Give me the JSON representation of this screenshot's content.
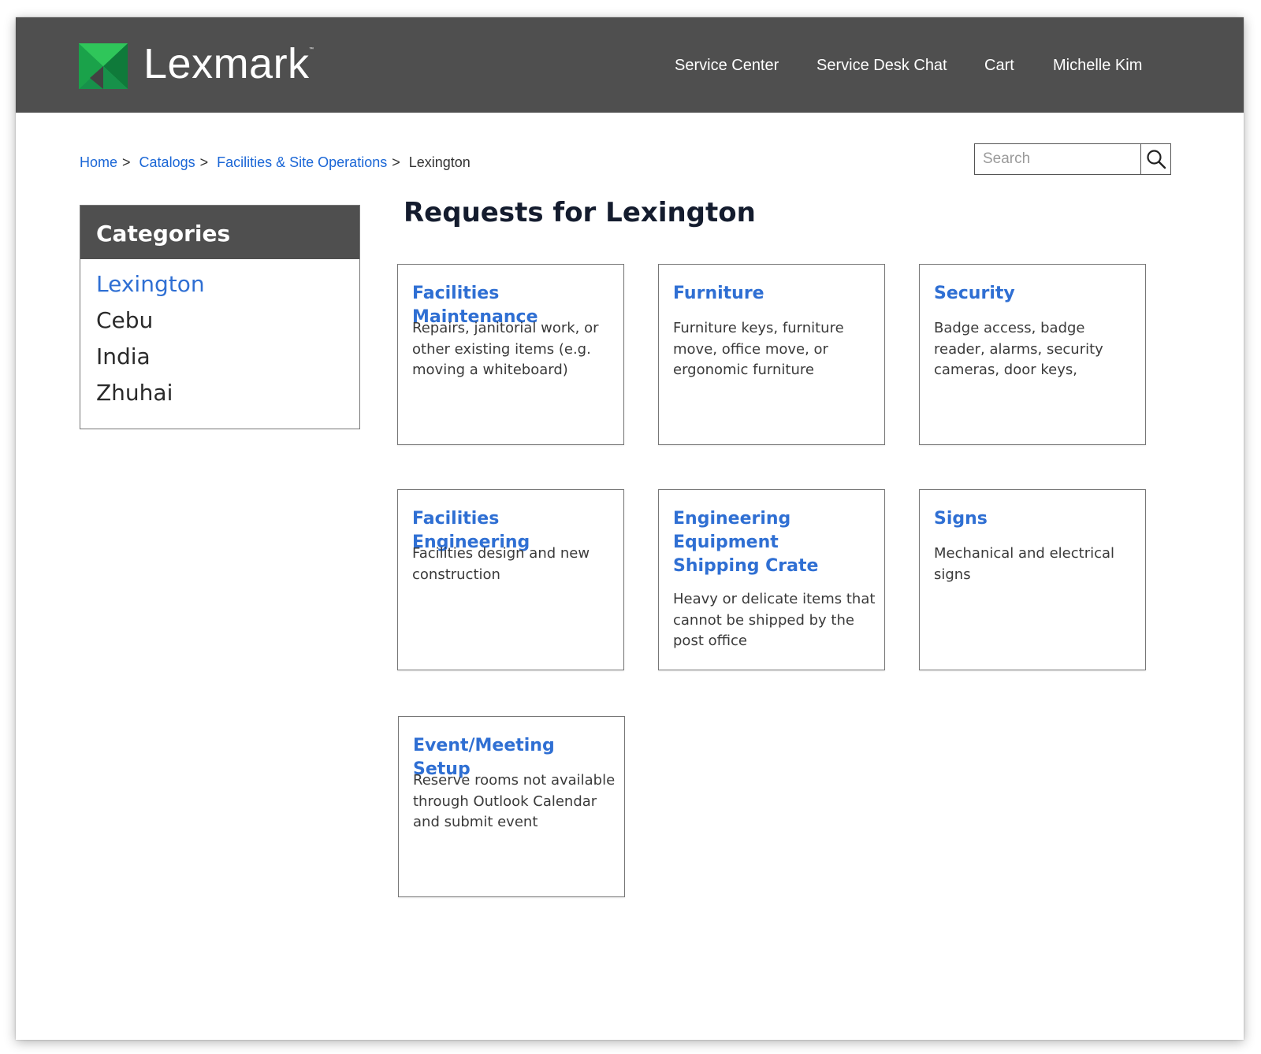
{
  "header": {
    "brand": "Lexmark",
    "trademark": "™",
    "nav": {
      "service_center": "Service Center",
      "service_desk_chat": "Service Desk Chat",
      "cart": "Cart",
      "user": "Michelle Kim"
    }
  },
  "colors": {
    "header_bg": "#4f4f4f",
    "link_blue": "#2f6fd3",
    "logo_green": "#2fc65a",
    "logo_dark_green": "#0f7a3a"
  },
  "breadcrumb": {
    "items": [
      "Home",
      "Catalogs",
      "Facilities & Site Operations"
    ],
    "current": "Lexington",
    "separator": ">"
  },
  "search": {
    "placeholder": "Search",
    "icon": "search-icon"
  },
  "categories": {
    "title": "Categories",
    "items": [
      "Lexington",
      "Cebu",
      "India",
      "Zhuhai"
    ],
    "active": "Lexington"
  },
  "main": {
    "title": "Requests for Lexington",
    "cards": [
      {
        "title": "Facilities Maintenance",
        "description": "Repairs, janitorial work, or other existing items (e.g. moving a whiteboard)"
      },
      {
        "title": "Furniture",
        "description": "Furniture keys, furniture move, office move, or ergonomic furniture"
      },
      {
        "title": "Security",
        "description": "Badge access, badge reader, alarms, security cameras, door keys,"
      },
      {
        "title": "Facilities Engineering",
        "description": "Facilities design and new construction"
      },
      {
        "title": "Engineering Equipment Shipping Crate",
        "description": "Heavy or delicate items that cannot be shipped by the post office"
      },
      {
        "title": "Signs",
        "description": "Mechanical and electrical signs"
      },
      {
        "title": "Event/Meeting Setup",
        "description": "Reserve rooms not available through Outlook Calendar and submit event"
      }
    ]
  }
}
